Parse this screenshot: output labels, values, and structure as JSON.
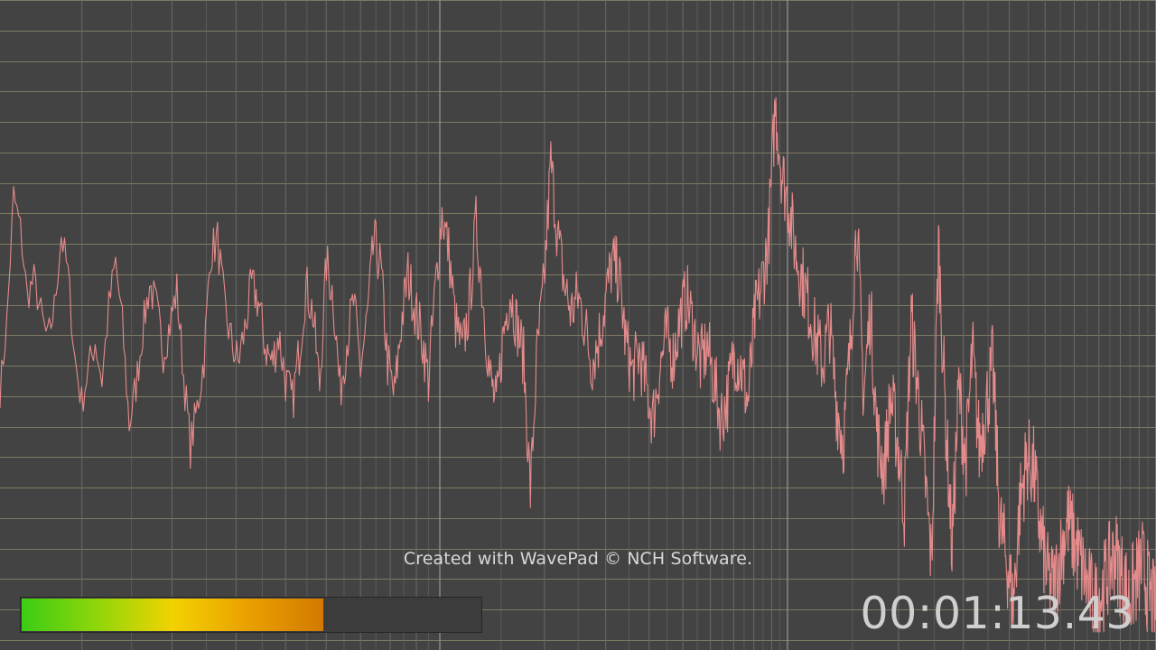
{
  "watermark": "Created with WavePad © NCH Software.",
  "time_display": "00:01:13.43",
  "level_meter": {
    "level_fraction": 0.655
  },
  "colors": {
    "background": "#434343",
    "waveform": "#e58b8b",
    "grid_minor_horizontal": "#7d7a62",
    "grid_vertical": "#6a6a6a",
    "grid_vertical_major": "#8f8f8f",
    "meter_gradient": [
      "#3ccc14",
      "#8fd60a",
      "#f2d200",
      "#eaa000",
      "#d27a00"
    ],
    "time_text": "#cfcfcf"
  },
  "chart_data": {
    "type": "line",
    "title": "",
    "xlabel": "",
    "ylabel": "",
    "xscale": "log",
    "grid": true,
    "series": [
      {
        "values": [
          0.43,
          0.55,
          0.78,
          0.72,
          0.6,
          0.63,
          0.57,
          0.52,
          0.58,
          0.71,
          0.64,
          0.49,
          0.41,
          0.47,
          0.52,
          0.45,
          0.58,
          0.66,
          0.55,
          0.37,
          0.44,
          0.54,
          0.62,
          0.58,
          0.5,
          0.55,
          0.61,
          0.46,
          0.33,
          0.4,
          0.49,
          0.68,
          0.7,
          0.58,
          0.52,
          0.48,
          0.54,
          0.62,
          0.59,
          0.51,
          0.48,
          0.53,
          0.45,
          0.41,
          0.5,
          0.62,
          0.57,
          0.44,
          0.66,
          0.6,
          0.43,
          0.52,
          0.59,
          0.47,
          0.56,
          0.7,
          0.65,
          0.48,
          0.42,
          0.55,
          0.64,
          0.58,
          0.53,
          0.45,
          0.61,
          0.75,
          0.68,
          0.55,
          0.5,
          0.58,
          0.73,
          0.6,
          0.46,
          0.4,
          0.53,
          0.61,
          0.55,
          0.49,
          0.25,
          0.5,
          0.62,
          0.84,
          0.71,
          0.62,
          0.57,
          0.6,
          0.55,
          0.48,
          0.52,
          0.59,
          0.66,
          0.64,
          0.52,
          0.46,
          0.5,
          0.44,
          0.38,
          0.47,
          0.53,
          0.49,
          0.56,
          0.6,
          0.54,
          0.48,
          0.51,
          0.45,
          0.38,
          0.42,
          0.5,
          0.47,
          0.41,
          0.56,
          0.62,
          0.7,
          0.94,
          0.82,
          0.76,
          0.68,
          0.63,
          0.58,
          0.52,
          0.48,
          0.55,
          0.41,
          0.34,
          0.5,
          0.74,
          0.42,
          0.58,
          0.35,
          0.29,
          0.42,
          0.34,
          0.22,
          0.56,
          0.43,
          0.28,
          0.12,
          0.7,
          0.4,
          0.15,
          0.44,
          0.3,
          0.5,
          0.33,
          0.4,
          0.48,
          0.2,
          0.13,
          0.05,
          0.23,
          0.31,
          0.29,
          0.18,
          0.1,
          0.08,
          0.14,
          0.2,
          0.16,
          0.12,
          0.08,
          0.05,
          0.07,
          0.11,
          0.14,
          0.1,
          0.06,
          0.09,
          0.12,
          0.07,
          0.03
        ]
      }
    ]
  }
}
